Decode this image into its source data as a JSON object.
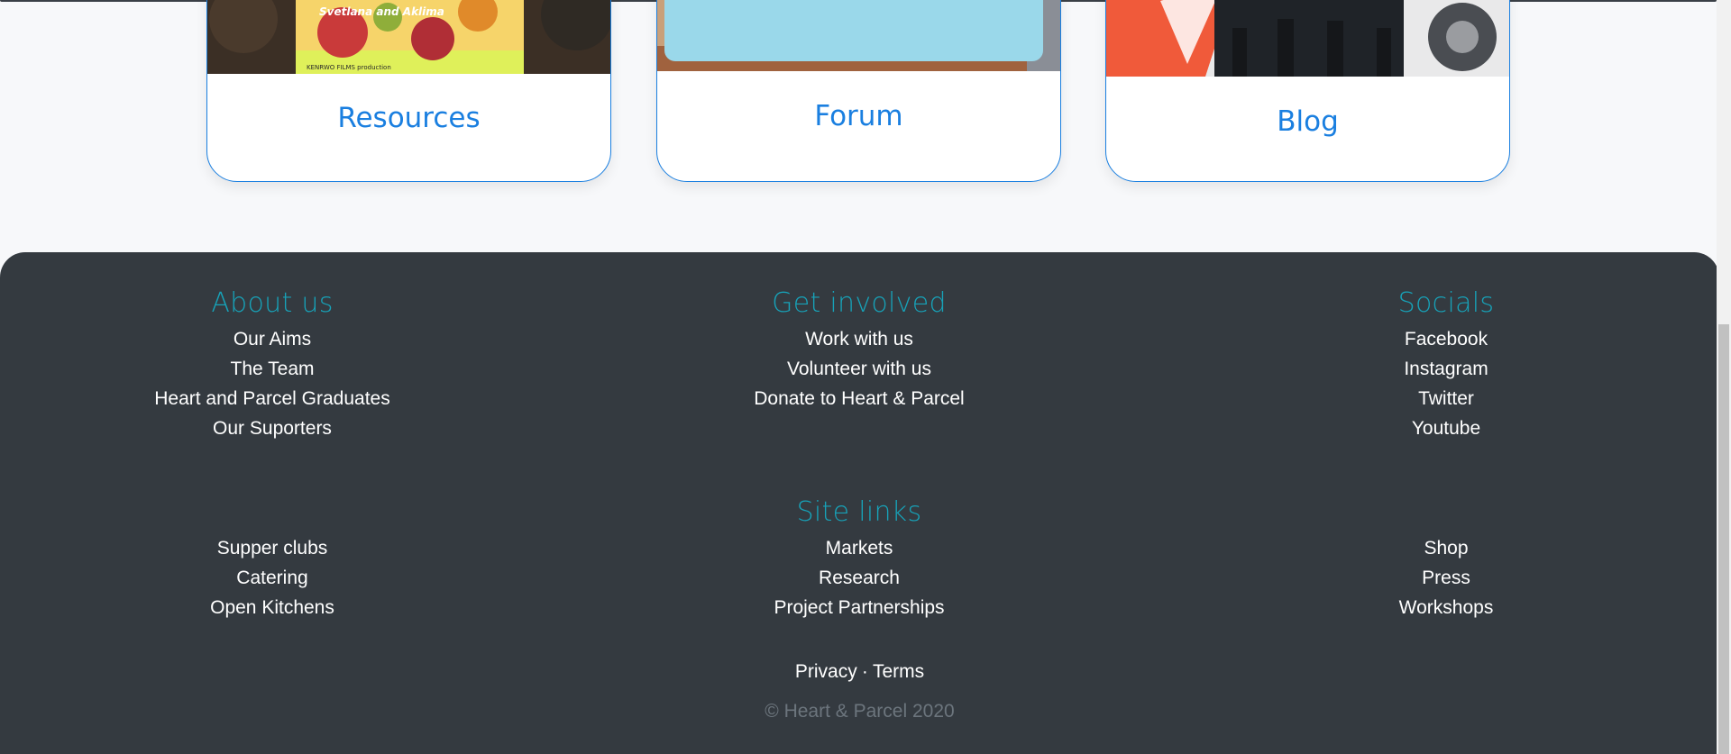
{
  "cards": [
    {
      "title": "Resources",
      "image_caption": "Svetlana and Aklima",
      "image_credit": "KENRWO FILMS production"
    },
    {
      "title": "Forum"
    },
    {
      "title": "Blog"
    }
  ],
  "footer": {
    "about": {
      "heading": "About us",
      "links": [
        "Our Aims",
        "The Team",
        "Heart and Parcel Graduates",
        "Our Suporters"
      ]
    },
    "involved": {
      "heading": "Get involved",
      "links": [
        "Work with us",
        "Volunteer with us",
        "Donate to Heart & Parcel"
      ]
    },
    "socials": {
      "heading": "Socials",
      "links": [
        "Facebook",
        "Instagram",
        "Twitter",
        "Youtube"
      ]
    },
    "site_links": {
      "heading": "Site links",
      "left": [
        "Supper clubs",
        "Catering",
        "Open Kitchens"
      ],
      "center": [
        "Markets",
        "Research",
        "Project Partnerships"
      ],
      "right": [
        "Shop",
        "Press",
        "Workshops"
      ]
    },
    "legal": {
      "privacy": "Privacy",
      "separator": "·",
      "terms": "Terms"
    },
    "copyright": "© Heart & Parcel 2020"
  },
  "colors": {
    "accent": "#1a7fe0",
    "teal": "#17a2b8",
    "footer_bg": "#343a40"
  }
}
